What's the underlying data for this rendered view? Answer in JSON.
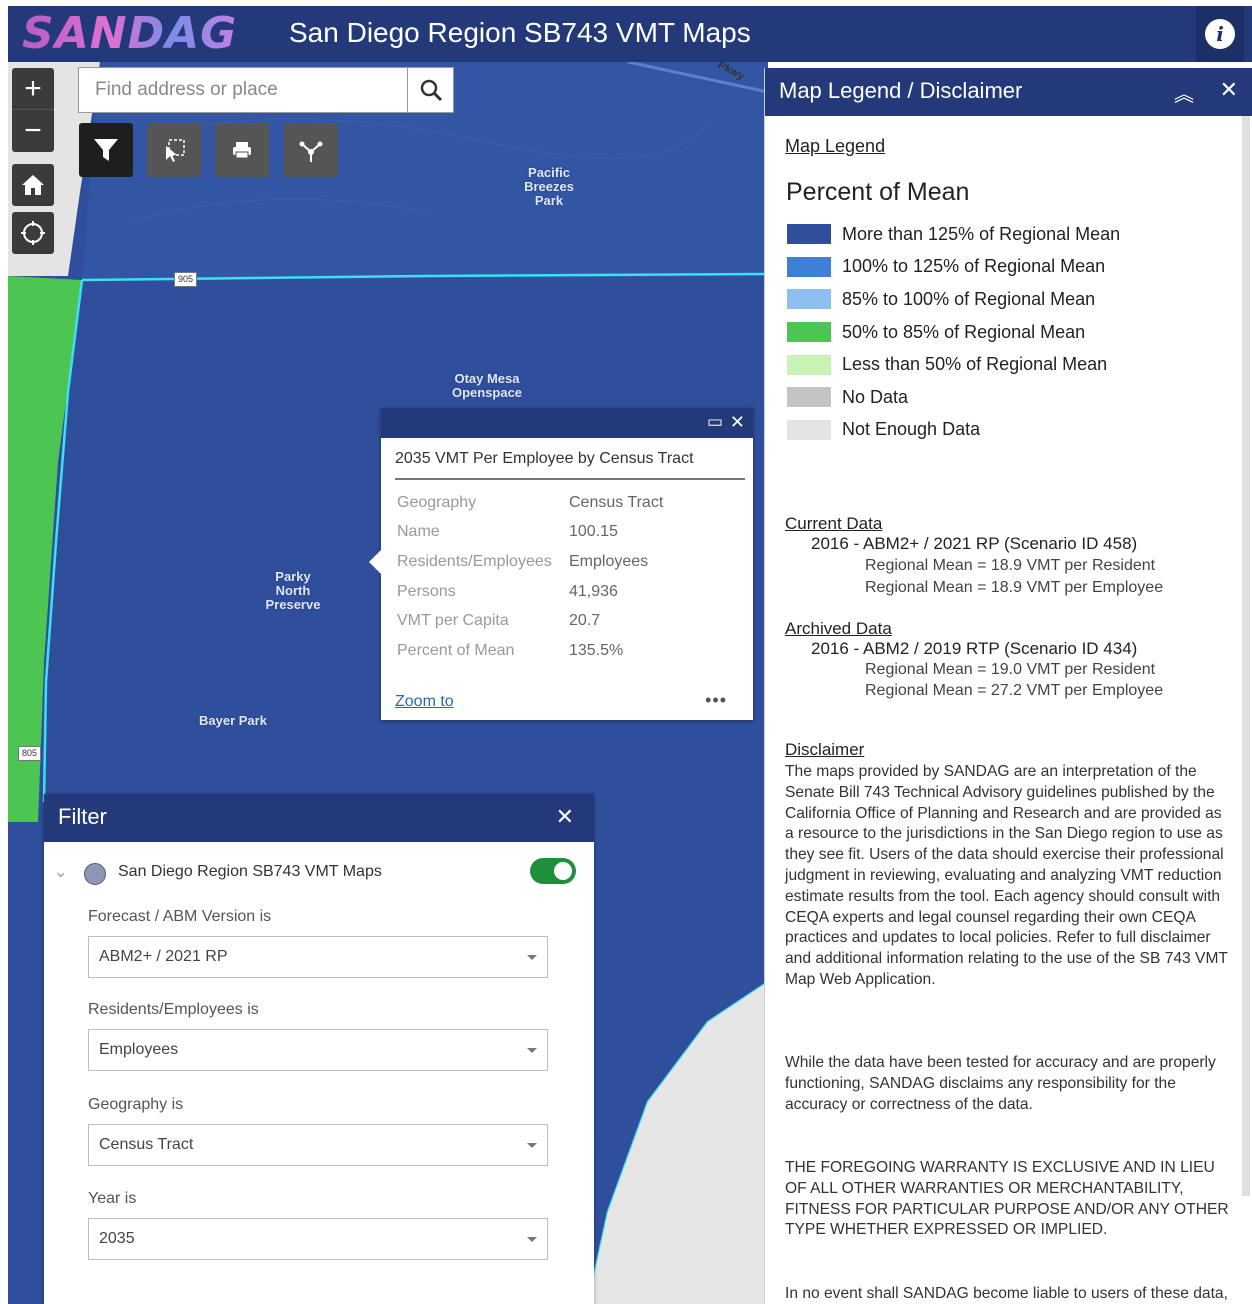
{
  "header": {
    "logo": "SANDAG",
    "title": "San Diego Region SB743 VMT Maps"
  },
  "map": {
    "search_placeholder": "Find address or place",
    "places": [
      "Pacific Breezes Park",
      "Otay Mesa Openspace",
      "Parky North Preserve",
      "Bayer Park"
    ],
    "highways": [
      "905",
      "805"
    ],
    "streets": [
      "Pkwy"
    ]
  },
  "popup": {
    "title": "2035 VMT Per Employee by Census Tract",
    "fields": [
      {
        "key": "Geography",
        "value": "Census Tract"
      },
      {
        "key": "Name",
        "value": "100.15"
      },
      {
        "key": "Residents/Employees",
        "value": "Employees"
      },
      {
        "key": "Persons",
        "value": "41,936"
      },
      {
        "key": "VMT per Capita",
        "value": "20.7"
      },
      {
        "key": "Percent of Mean",
        "value": "135.5%"
      }
    ],
    "zoom_link": "Zoom to",
    "more": "•••"
  },
  "filter": {
    "title": "Filter",
    "layer_name": "San Diego Region SB743 VMT Maps",
    "layer_enabled": true,
    "fields": [
      {
        "label": "Forecast / ABM Version is",
        "value": "ABM2+ / 2021 RP"
      },
      {
        "label": "Residents/Employees is",
        "value": "Employees"
      },
      {
        "label": "Geography is",
        "value": "Census Tract"
      },
      {
        "label": "Year is",
        "value": "2035"
      }
    ]
  },
  "legend": {
    "title": "Map Legend / Disclaimer",
    "map_legend_link": "Map Legend",
    "heading": "Percent of Mean",
    "items": [
      {
        "label": "More than 125% of Regional Mean",
        "color": "#2f4f9c"
      },
      {
        "label": "100% to 125% of Regional Mean",
        "color": "#3f7fd6"
      },
      {
        "label": "85% to 100% of Regional Mean",
        "color": "#8fbff0"
      },
      {
        "label": "50% to 85% of Regional Mean",
        "color": "#4cc552"
      },
      {
        "label": "Less than 50% of Regional Mean",
        "color": "#c8f3b4"
      },
      {
        "label": "No Data",
        "color": "#c4c4c4"
      },
      {
        "label": "Not Enough Data",
        "color": "#e3e3e3"
      }
    ],
    "current": {
      "heading": "Current Data",
      "scenario": "2016 - ABM2+ / 2021 RP (Scenario ID 458)",
      "line1": "Regional Mean = 18.9 VMT per Resident",
      "line2": "Regional Mean = 18.9 VMT per Employee"
    },
    "archived": {
      "heading": "Archived Data",
      "scenario": "2016 - ABM2 / 2019 RTP (Scenario ID 434)",
      "line1": "Regional Mean = 19.0 VMT per Resident",
      "line2": "Regional Mean = 27.2 VMT per Employee"
    },
    "disclaimer_heading": "Disclaimer",
    "para1": "The maps provided by SANDAG are an interpretation of the Senate Bill 743 Technical Advisory guidelines published by the California Office of Planning and Research and are provided as a resource to the jurisdictions in the San Diego region to use as they see fit. Users of the data should exercise their professional judgment in reviewing, evaluating and analyzing VMT reduction estimate results from the tool. Each agency should consult with CEQA experts and legal counsel regarding their own CEQA practices and updates to local policies. Refer to full disclaimer and additional information relating to the use of the SB 743 VMT Map Web Application.",
    "para2": "While the data have been tested for accuracy and are properly functioning, SANDAG disclaims any responsibility for the accuracy or correctness of the data.",
    "para3": "THE FOREGOING WARRANTY IS EXCLUSIVE AND IN LIEU OF ALL OTHER WARRANTIES OR MERCHANTABILITY, FITNESS FOR PARTICULAR PURPOSE AND/OR ANY OTHER TYPE WHETHER EXPRESSED OR IMPLIED.",
    "para4": "In no event shall SANDAG become liable to users of these data, or any other party, for any loss or damages, consequential or otherwise, including but not limited"
  }
}
